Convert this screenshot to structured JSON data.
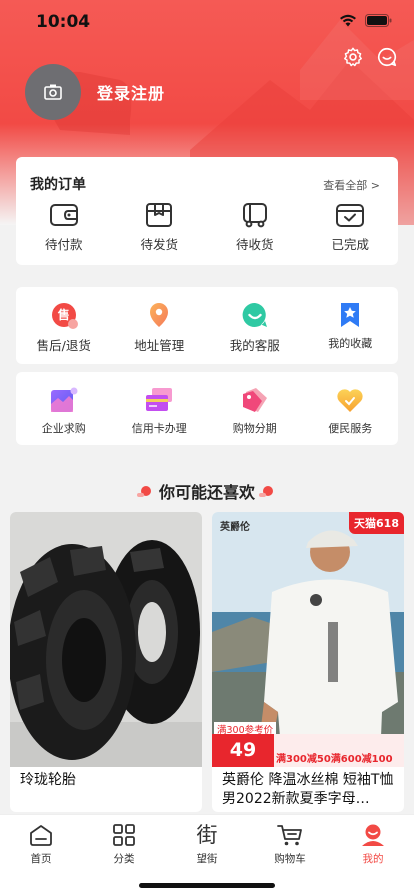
{
  "status_bar": {
    "time": "10:04"
  },
  "profile": {
    "login_label": "登录注册"
  },
  "orders": {
    "title": "我的订单",
    "view_all": "查看全部 >",
    "items": [
      {
        "label": "待付款",
        "icon": "wallet-icon"
      },
      {
        "label": "待发货",
        "icon": "box-icon"
      },
      {
        "label": "待收货",
        "icon": "truck-icon"
      },
      {
        "label": "已完成",
        "icon": "check-box-icon"
      }
    ]
  },
  "services": {
    "items": [
      {
        "label": "售后/退货",
        "icon": "aftersale-icon",
        "badge": "售"
      },
      {
        "label": "地址管理",
        "icon": "location-pin-icon"
      },
      {
        "label": "我的客服",
        "icon": "customer-service-icon"
      },
      {
        "label": "我的收藏",
        "icon": "bookmark-star-icon"
      }
    ]
  },
  "tools": {
    "items": [
      {
        "label": "企业求购",
        "icon": "enterprise-icon"
      },
      {
        "label": "信用卡办理",
        "icon": "credit-card-icon"
      },
      {
        "label": "购物分期",
        "icon": "installment-tag-icon"
      },
      {
        "label": "便民服务",
        "icon": "heart-service-icon"
      }
    ]
  },
  "recommend": {
    "title": "你可能还喜欢"
  },
  "products": [
    {
      "name": "玲珑轮胎"
    },
    {
      "name": "英爵伦 降温冰丝棉 短袖T恤男2022新款夏季字母…",
      "brand": "英爵伦",
      "badge": "天猫618",
      "ref_label": "满300参考价",
      "price": "49",
      "promo": "满300减50满600减100"
    }
  ],
  "tab_bar": {
    "items": [
      {
        "label": "首页",
        "icon": "home-icon"
      },
      {
        "label": "分类",
        "icon": "grid-icon"
      },
      {
        "label": "望街",
        "icon": "street-icon",
        "glyph": "街"
      },
      {
        "label": "购物车",
        "icon": "cart-icon"
      },
      {
        "label": "我的",
        "icon": "profile-icon",
        "active": true
      }
    ]
  },
  "colors": {
    "brand_red": "#f24a45",
    "price_red": "#e8262d"
  }
}
